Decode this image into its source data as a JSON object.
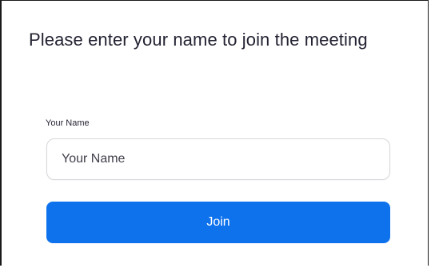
{
  "page": {
    "title": "Please enter your name to join the meeting"
  },
  "form": {
    "name_label": "Your Name",
    "name_placeholder": "Your Name",
    "name_value": "",
    "join_label": "Join"
  },
  "colors": {
    "accent": "#0e72ed",
    "text": "#232333",
    "input_border": "#d7d7dc"
  }
}
